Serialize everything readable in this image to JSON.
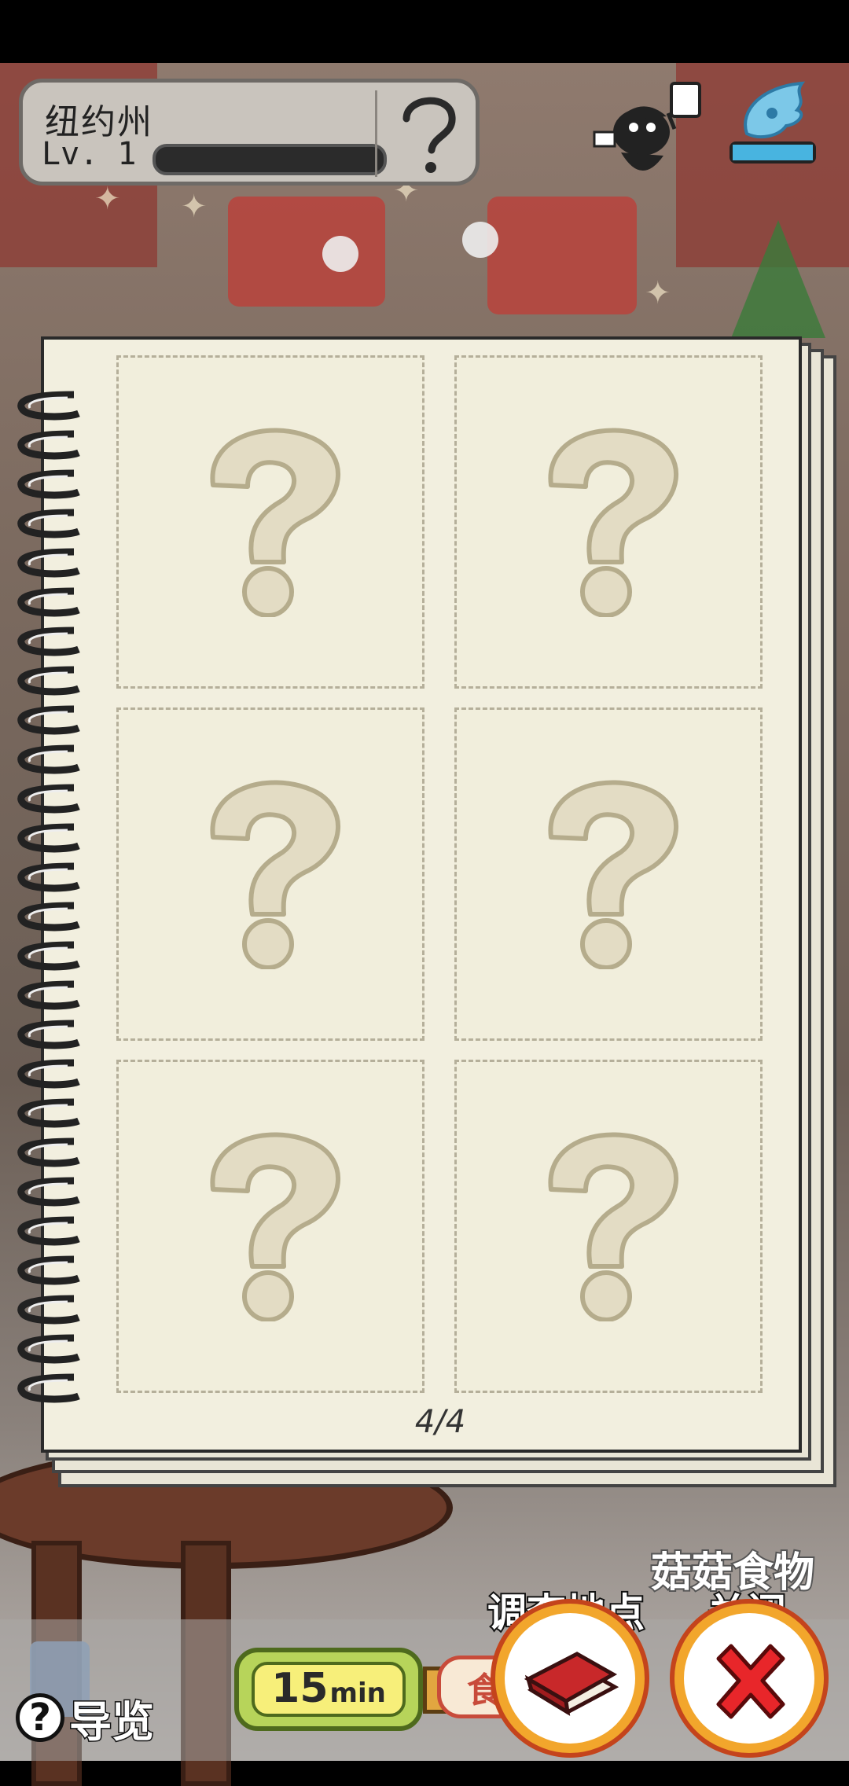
{
  "location": {
    "name": "纽约州",
    "level": "Lv. 1",
    "progress": 0,
    "help_icon": "question-mark-icon"
  },
  "battery": {
    "level": 1.0,
    "color": "#48b4e0"
  },
  "notebook": {
    "slots": [
      {
        "state": "unknown",
        "icon": "question-mark-icon"
      },
      {
        "state": "unknown",
        "icon": "question-mark-icon"
      },
      {
        "state": "unknown",
        "icon": "question-mark-icon"
      },
      {
        "state": "unknown",
        "icon": "question-mark-icon"
      },
      {
        "state": "unknown",
        "icon": "question-mark-icon"
      },
      {
        "state": "unknown",
        "icon": "question-mark-icon"
      }
    ],
    "page": "4/4"
  },
  "bottom": {
    "guide_icon": "?",
    "guide_label": "导览",
    "timer_value": "15",
    "timer_unit": "min",
    "food_tag_text": "食",
    "mushroom_food_label": "菇菇食物",
    "investigate_label": "调查地点",
    "investigate_icon": "red-book-icon",
    "close_label": "关闭",
    "close_icon": "red-x-icon"
  },
  "colors": {
    "accent_orange": "#f2a62c",
    "close_red": "#e8262a",
    "paper": "#f2efdf"
  }
}
